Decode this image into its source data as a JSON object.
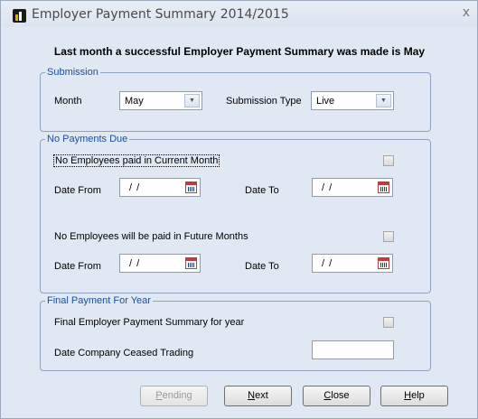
{
  "window": {
    "title": "Employer Payment Summary 2014/2015",
    "close_glyph": "x"
  },
  "heading": "Last month a successful Employer Payment Summary was made is May",
  "submission": {
    "legend": "Submission",
    "month_label": "Month",
    "month_value": "May",
    "type_label": "Submission Type",
    "type_value": "Live"
  },
  "no_payments": {
    "legend": "No Payments Due",
    "current_label": "No Employees paid in Current Month",
    "current_checked": false,
    "date_from_label": "Date From",
    "date_to_label": "Date To",
    "current_from": "/ /",
    "current_to": "/ /",
    "future_label": "No Employees will be paid in Future Months",
    "future_checked": false,
    "future_from": "/ /",
    "future_to": "/ /"
  },
  "final_payment": {
    "legend": "Final Payment For Year",
    "final_label": "Final Employer Payment Summary for year",
    "final_checked": false,
    "ceased_label": "Date Company Ceased Trading",
    "ceased_value": ""
  },
  "buttons": {
    "pending": {
      "mnemonic": "P",
      "rest": "ending",
      "enabled": false
    },
    "next": {
      "mnemonic": "N",
      "rest": "ext",
      "enabled": true
    },
    "close": {
      "mnemonic": "C",
      "rest": "lose",
      "enabled": true
    },
    "help": {
      "mnemonic": "H",
      "rest": "elp",
      "enabled": true
    }
  },
  "icons": {
    "app": "payroll-app-icon",
    "dropdown": "chevron-down-icon",
    "calendar": "calendar-icon",
    "close": "close-icon"
  },
  "colors": {
    "window_bg": "#dfe8f3",
    "group_legend": "#1d4fa0",
    "group_border": "#8ea2bf"
  }
}
